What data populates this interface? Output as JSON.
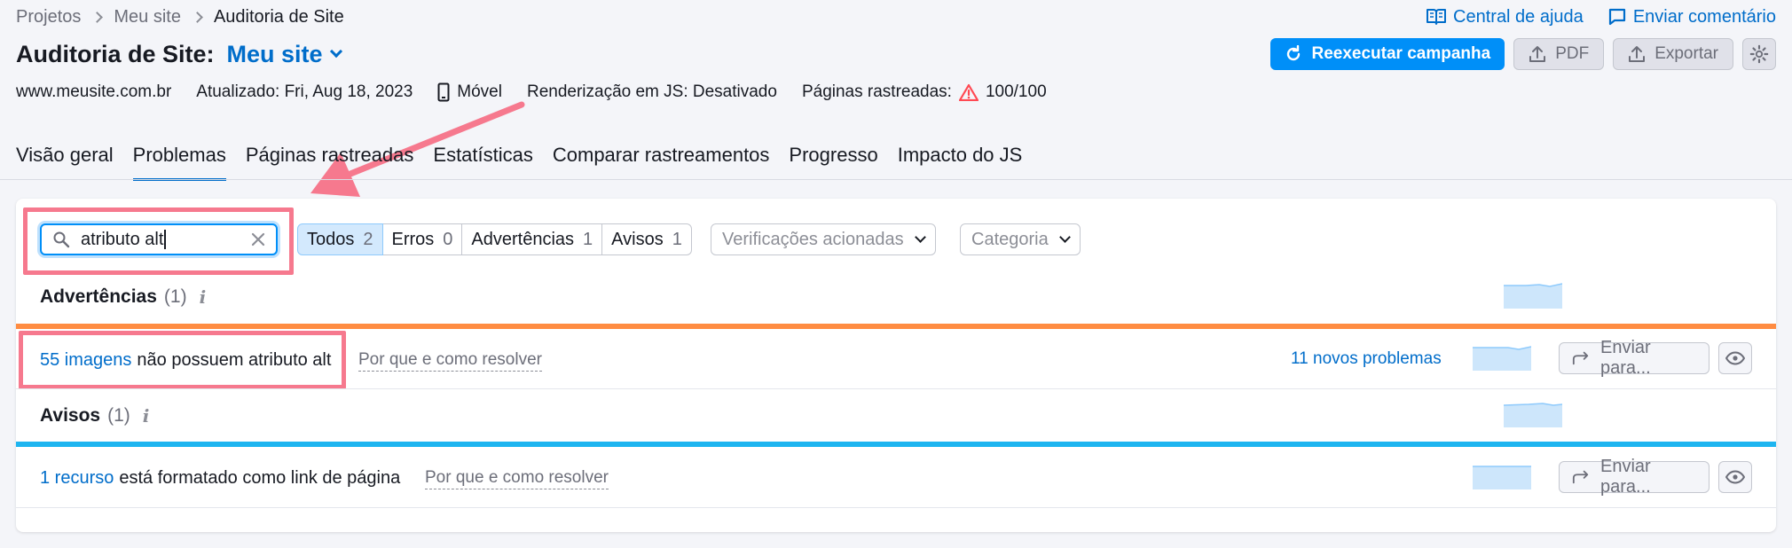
{
  "breadcrumb": {
    "items": [
      "Projetos",
      "Meu site",
      "Auditoria de Site"
    ]
  },
  "toplinks": {
    "help": "Central de ajuda",
    "feedback": "Enviar comentário"
  },
  "header": {
    "title": "Auditoria de Site:",
    "project": "Meu site"
  },
  "actions": {
    "rerun": "Reexecutar campanha",
    "pdf": "PDF",
    "export": "Exportar"
  },
  "meta": {
    "domain": "www.meusite.com.br",
    "updated": "Atualizado: Fri, Aug 18, 2023",
    "device": "Móvel",
    "js_render": "Renderização em JS: Desativado",
    "crawled_label": "Páginas rastreadas:",
    "crawled_value": "100/100"
  },
  "tabs": [
    "Visão geral",
    "Problemas",
    "Páginas rastreadas",
    "Estatísticas",
    "Comparar rastreamentos",
    "Progresso",
    "Impacto do JS"
  ],
  "search": {
    "value": "atributo alt"
  },
  "filters": [
    {
      "label": "Todos",
      "count": "2"
    },
    {
      "label": "Erros",
      "count": "0"
    },
    {
      "label": "Advertências",
      "count": "1"
    },
    {
      "label": "Avisos",
      "count": "1"
    }
  ],
  "dropdowns": {
    "checks": "Verificações acionadas",
    "category": "Categoria"
  },
  "sections": {
    "warnings": {
      "title": "Advertências",
      "count": "(1)",
      "issue": {
        "link": "55 imagens",
        "text": "não possuem atributo alt",
        "why": "Por que e como resolver",
        "new": "11 novos problemas",
        "send": "Enviar para..."
      }
    },
    "notices": {
      "title": "Avisos",
      "count": "(1)",
      "issue": {
        "link": "1 recurso",
        "text": "está formatado como link de página",
        "why": "Por que e como resolver",
        "send": "Enviar para..."
      }
    }
  },
  "colors": {
    "accent": "#006dca",
    "primary": "#008ff8",
    "warning": "#ff8c42",
    "notice": "#1eb5f0",
    "highlight": "#f6798e"
  }
}
